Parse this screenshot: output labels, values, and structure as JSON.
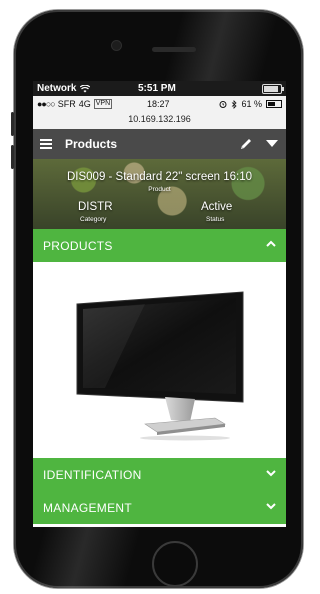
{
  "os_status": {
    "network": "Network",
    "time": "5:51 PM"
  },
  "web_status": {
    "carrier_signal": "●●○○",
    "carrier": "SFR",
    "network_type": "4G",
    "vpn": "VPN",
    "time": "18:27",
    "battery": "61 %",
    "url": "10.169.132.196"
  },
  "app_bar": {
    "title": "Products"
  },
  "header": {
    "product_title": "DIS009 - Standard 22\" screen 16:10",
    "product_label": "Product",
    "category_value": "DISTR",
    "category_label": "Category",
    "status_value": "Active",
    "status_label": "Status"
  },
  "sections": {
    "products": "PRODUCTS",
    "identification": "IDENTIFICATION",
    "management": "MANAGEMENT"
  },
  "colors": {
    "accent_green": "#4fb540",
    "app_bar_bg": "#4a4a4a"
  },
  "icons": {
    "menu": "hamburger-menu-icon",
    "edit": "pencil-icon",
    "dropdown": "chevron-down-icon",
    "collapse": "chevron-up-icon"
  }
}
